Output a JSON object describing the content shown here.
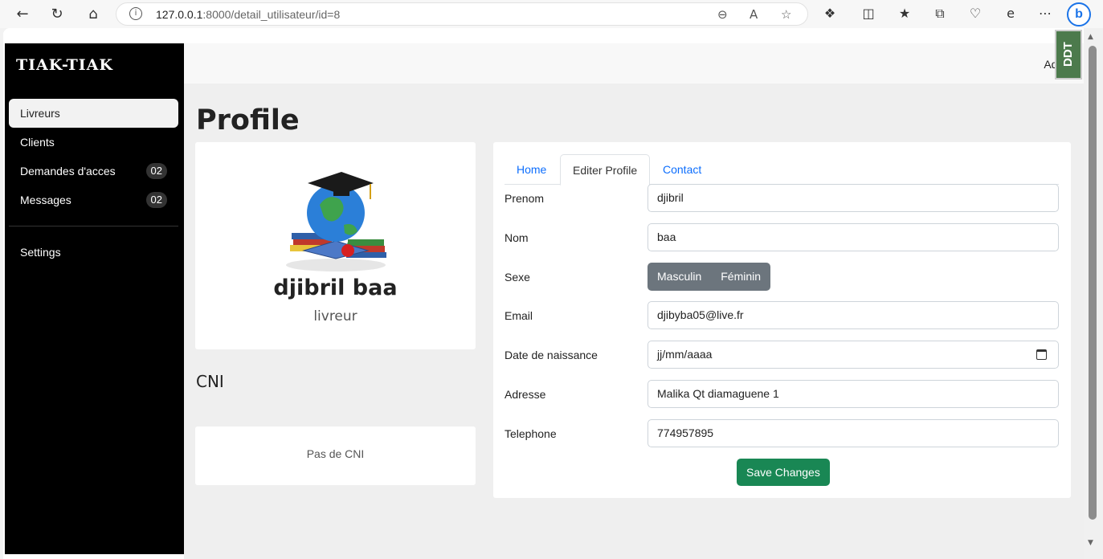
{
  "browser": {
    "url_host": "127.0.0.1",
    "url_rest": ":8000/detail_utilisateur/id=8",
    "info_icon": "i",
    "bing_label": "b"
  },
  "app": {
    "brand": "TIAK-TIAK",
    "admin_label": "Admin",
    "ddt_label": "DDT"
  },
  "sidebar": {
    "items": [
      {
        "label": "Livreurs",
        "badge": ""
      },
      {
        "label": "Clients",
        "badge": ""
      },
      {
        "label": "Demandes d'acces",
        "badge": "02"
      },
      {
        "label": "Messages",
        "badge": "02"
      }
    ],
    "settings_label": "Settings"
  },
  "page": {
    "title": "Profile"
  },
  "profile": {
    "name": "djibril baa",
    "role": "livreur"
  },
  "cni": {
    "title": "CNI",
    "empty_text": "Pas de CNI"
  },
  "tabs": [
    {
      "label": "Home"
    },
    {
      "label": "Editer Profile"
    },
    {
      "label": "Contact"
    }
  ],
  "form": {
    "prenom_label": "Prenom",
    "prenom_value": "djibril",
    "nom_label": "Nom",
    "nom_value": "baa",
    "sexe_label": "Sexe",
    "sexe_option_1": "Masculin",
    "sexe_option_2": "Féminin",
    "email_label": "Email",
    "email_value": "djibyba05@live.fr",
    "naissance_label": "Date de naissance",
    "naissance_placeholder": "jj/mm/aaaa",
    "adresse_label": "Adresse",
    "adresse_value": "Malika Qt diamaguene 1",
    "telephone_label": "Telephone",
    "telephone_value": "774957895",
    "save_label": "Save Changes"
  },
  "colors": {
    "sidebar_bg": "#000000",
    "link": "#0d6efd",
    "save_button": "#198754",
    "segment_button": "#6c757d"
  }
}
